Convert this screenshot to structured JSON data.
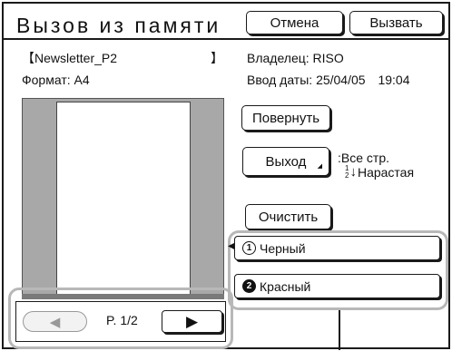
{
  "header": {
    "title": "Вызов из памяти",
    "cancel_label": "Отмена",
    "recall_label": "Вызвать"
  },
  "document": {
    "name": "【Newsletter_P2",
    "name_close": "】",
    "format_label": "Формат:",
    "format_value": "A4",
    "owner_label": "Владелец:",
    "owner_value": "RISO",
    "date_label": "Ввод даты:",
    "date_value": "25/04/05",
    "time_value": "19:04"
  },
  "controls": {
    "rotate_label": "Повернуть",
    "output_label": "Выход",
    "output_pages": ":Все стр.",
    "output_order": "Нарастая",
    "order_icon_digits": [
      "1",
      "2"
    ],
    "clear_label": "Очистить"
  },
  "drums": [
    {
      "number": "1",
      "label": "Черный",
      "selected": true
    },
    {
      "number": "2",
      "label": "Красный",
      "selected": false
    }
  ],
  "pager": {
    "prev_icon": "◀",
    "page_text": "P. 1/2",
    "next_icon": "▶"
  }
}
